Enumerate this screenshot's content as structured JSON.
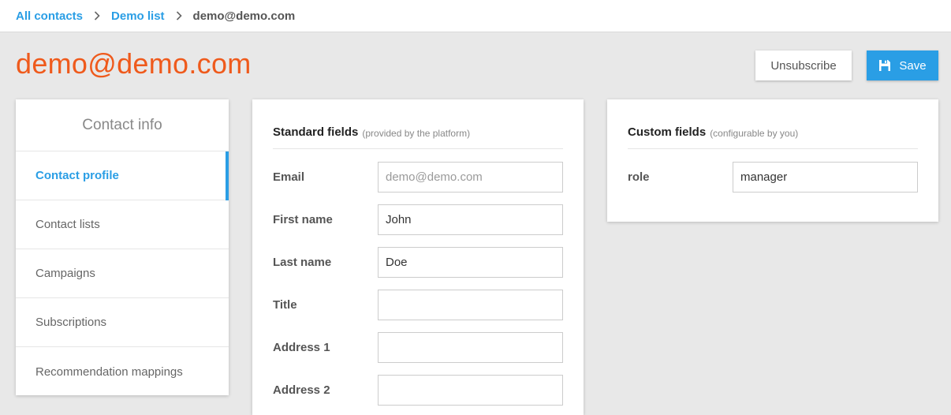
{
  "breadcrumb": {
    "items": [
      {
        "label": "All contacts"
      },
      {
        "label": "Demo list"
      }
    ],
    "current": "demo@demo.com"
  },
  "page": {
    "title": "demo@demo.com",
    "title_color": "#ef5a1c"
  },
  "actions": {
    "unsubscribe_label": "Unsubscribe",
    "save_label": "Save",
    "save_icon": "floppy-disk-icon",
    "accent": "#2a9ee5"
  },
  "sidebar": {
    "header": "Contact info",
    "items": [
      {
        "label": "Contact profile",
        "active": true
      },
      {
        "label": "Contact lists",
        "active": false
      },
      {
        "label": "Campaigns",
        "active": false
      },
      {
        "label": "Subscriptions",
        "active": false
      },
      {
        "label": "Recommendation mappings",
        "active": false
      }
    ]
  },
  "standard_fields": {
    "title": "Standard fields",
    "subtitle": "(provided by the platform)",
    "fields": [
      {
        "label": "Email",
        "value": "",
        "placeholder": "demo@demo.com"
      },
      {
        "label": "First name",
        "value": "John",
        "placeholder": ""
      },
      {
        "label": "Last name",
        "value": "Doe",
        "placeholder": ""
      },
      {
        "label": "Title",
        "value": "",
        "placeholder": ""
      },
      {
        "label": "Address 1",
        "value": "",
        "placeholder": ""
      },
      {
        "label": "Address 2",
        "value": "",
        "placeholder": ""
      }
    ]
  },
  "custom_fields": {
    "title": "Custom fields",
    "subtitle": "(configurable by you)",
    "fields": [
      {
        "label": "role",
        "value": "manager",
        "placeholder": ""
      }
    ]
  }
}
